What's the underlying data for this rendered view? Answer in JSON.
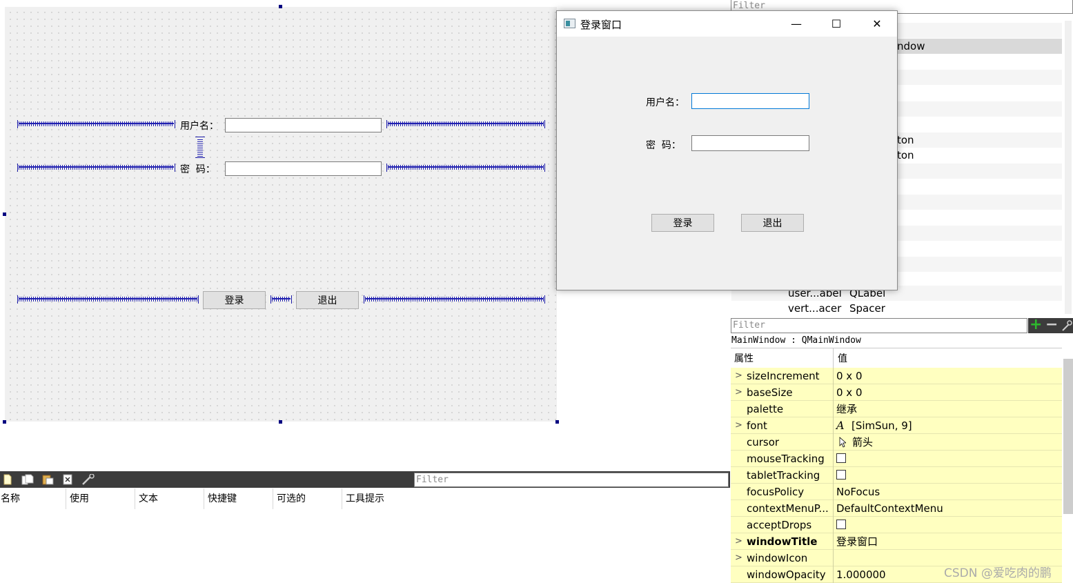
{
  "designer": {
    "username_label": "用户名：",
    "password_label": "密  码：",
    "login_button": "登录",
    "exit_button": "退出"
  },
  "dialog": {
    "title": "登录窗口",
    "username_label": "用户名：",
    "password_label": "密  码：",
    "login_button": "登录",
    "exit_button": "退出",
    "minimize_glyph": "—",
    "maximize_glyph": "☐",
    "close_glyph": "✕"
  },
  "object_inspector": {
    "filter_placeholder": "Filter",
    "rows": [
      {
        "name": "",
        "class": "ndow"
      },
      {
        "name": "",
        "class": "ton"
      },
      {
        "name": "",
        "class": "ton"
      },
      {
        "name": "user...abel",
        "class": "QLabel"
      },
      {
        "name": "vert...acer",
        "class": "Spacer"
      }
    ]
  },
  "action_editor": {
    "filter_placeholder": "Filter",
    "columns": [
      "名称",
      "使用",
      "文本",
      "快捷键",
      "可选的",
      "工具提示"
    ],
    "tools": [
      "new-action-icon",
      "copy-action-icon",
      "paste-action-icon",
      "delete-action-icon",
      "configure-icon"
    ]
  },
  "property_editor": {
    "filter_placeholder": "Filter",
    "class_line": "MainWindow : QMainWindow",
    "header_property": "属性",
    "header_value": "值",
    "add_glyph": "+",
    "remove_glyph": "−",
    "properties": [
      {
        "name": "sizeIncrement",
        "value": "0 x 0",
        "expandable": true
      },
      {
        "name": "baseSize",
        "value": "0 x 0",
        "expandable": true
      },
      {
        "name": "palette",
        "value": "继承",
        "expandable": false
      },
      {
        "name": "font",
        "value": "[SimSun, 9]",
        "expandable": true,
        "icon": "A"
      },
      {
        "name": "cursor",
        "value": "箭头",
        "expandable": false,
        "icon": "arrow"
      },
      {
        "name": "mouseTracking",
        "value": "",
        "checkbox": true
      },
      {
        "name": "tabletTracking",
        "value": "",
        "checkbox": true
      },
      {
        "name": "focusPolicy",
        "value": "NoFocus",
        "expandable": false
      },
      {
        "name": "contextMenuP...",
        "value": "DefaultContextMenu",
        "expandable": false
      },
      {
        "name": "acceptDrops",
        "value": "",
        "checkbox": true
      },
      {
        "name": "windowTitle",
        "value": "登录窗口",
        "expandable": true,
        "bold": true
      },
      {
        "name": "windowIcon",
        "value": "",
        "expandable": true
      },
      {
        "name": "windowOpacity",
        "value": "1.000000",
        "expandable": false
      }
    ]
  },
  "watermark": "CSDN @爱吃肉的鹏",
  "colors": {
    "spacer": "#2020b0",
    "property_bg": "#ffffc0",
    "selection": "#d9d9d9",
    "toolbar_dark": "#3c3c3c",
    "focus_border": "#0078d7"
  }
}
